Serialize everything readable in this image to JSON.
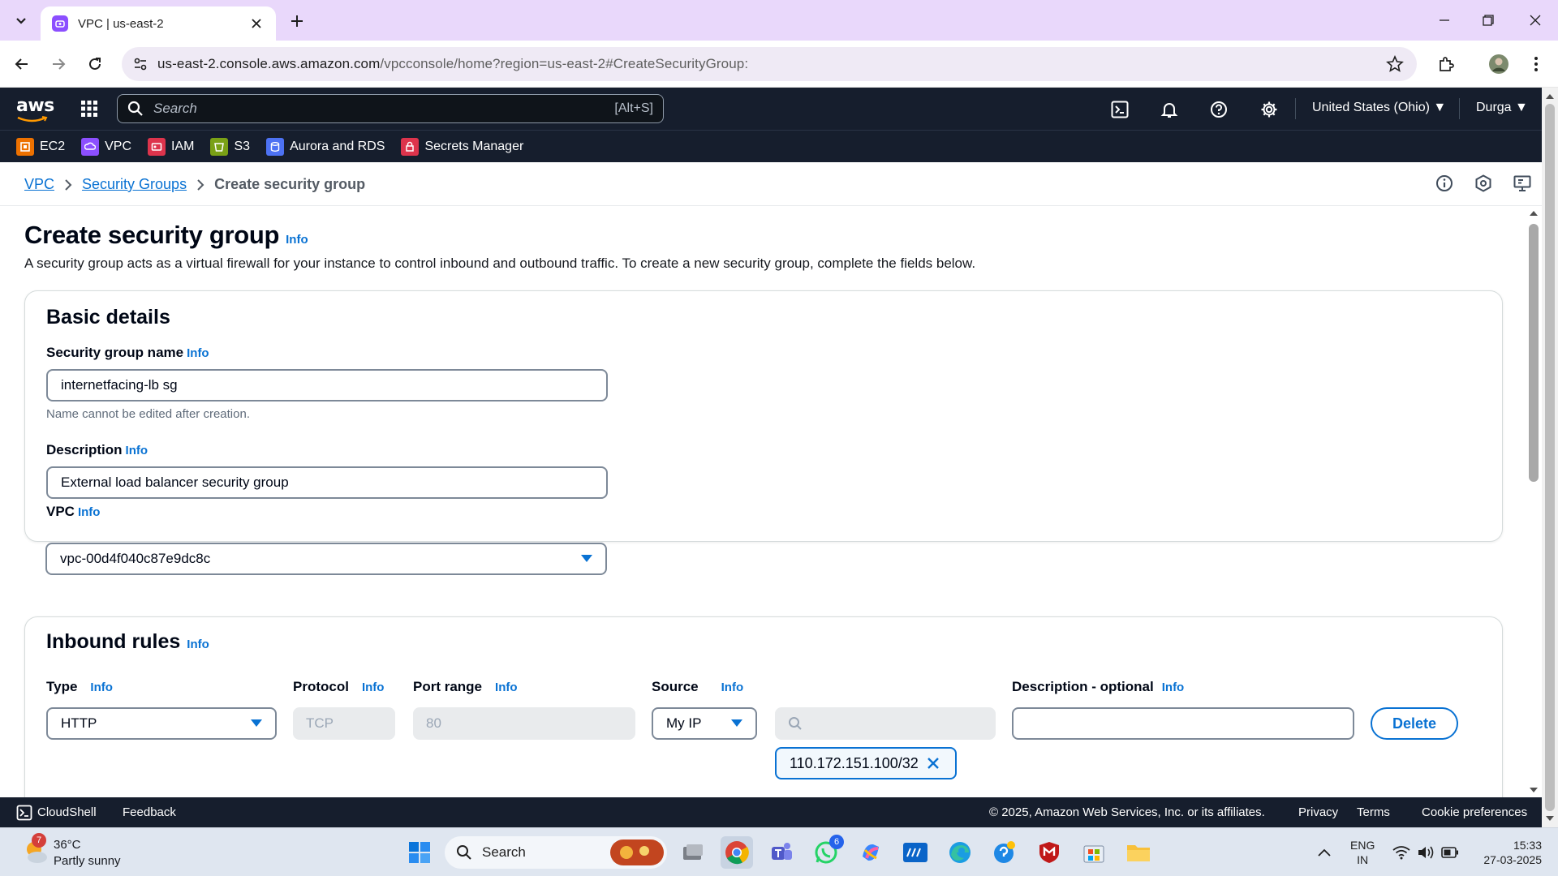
{
  "browser": {
    "tab_title": "VPC | us-east-2",
    "url_host": "us-east-2.console.aws.amazon.com",
    "url_path": "/vpcconsole/home?region=us-east-2#CreateSecurityGroup:"
  },
  "aws_header": {
    "logo": "aws",
    "search_placeholder": "Search",
    "search_shortcut": "[Alt+S]",
    "region": "United States (Ohio) ▼",
    "user": "Durga ▼"
  },
  "services": [
    {
      "label": "EC2",
      "color": "#ed7100"
    },
    {
      "label": "VPC",
      "color": "#8c4fff"
    },
    {
      "label": "IAM",
      "color": "#dd344c"
    },
    {
      "label": "S3",
      "color": "#7aa116"
    },
    {
      "label": "Aurora and RDS",
      "color": "#4d72f3"
    },
    {
      "label": "Secrets Manager",
      "color": "#dd344c"
    }
  ],
  "breadcrumb": {
    "items": [
      "VPC",
      "Security Groups"
    ],
    "current": "Create security group"
  },
  "page": {
    "title": "Create security group",
    "info": "Info",
    "description": "A security group acts as a virtual firewall for your instance to control inbound and outbound traffic. To create a new security group, complete the fields below."
  },
  "basic_details": {
    "heading": "Basic details",
    "name_label": "Security group name",
    "name_value": "internetfacing-lb sg",
    "name_hint": "Name cannot be edited after creation.",
    "description_label": "Description",
    "description_value": "External load balancer security group",
    "vpc_label": "VPC",
    "vpc_value": "vpc-00d4f040c87e9dc8c"
  },
  "inbound_rules": {
    "heading": "Inbound rules",
    "columns": {
      "type": "Type",
      "protocol": "Protocol",
      "port_range": "Port range",
      "source": "Source",
      "description": "Description - optional"
    },
    "rule": {
      "type": "HTTP",
      "protocol": "TCP",
      "port_range": "80",
      "source": "My IP",
      "source_search": "",
      "source_token": "110.172.151.100/32",
      "description": "",
      "delete_label": "Delete"
    }
  },
  "footer": {
    "cloudshell": "CloudShell",
    "feedback": "Feedback",
    "copyright": "© 2025, Amazon Web Services, Inc. or its affiliates.",
    "privacy": "Privacy",
    "terms": "Terms",
    "cookies": "Cookie preferences"
  },
  "taskbar": {
    "weather_temp": "36°C",
    "weather_desc": "Partly sunny",
    "weather_badge": "7",
    "search_label": "Search",
    "whatsapp_badge": "6",
    "language_top": "ENG",
    "language_bottom": "IN",
    "time": "15:33",
    "date": "27-03-2025"
  },
  "colors": {
    "aws_nav": "#161e2d",
    "link": "#0972d3",
    "tab_strip": "#e9d8fb"
  }
}
